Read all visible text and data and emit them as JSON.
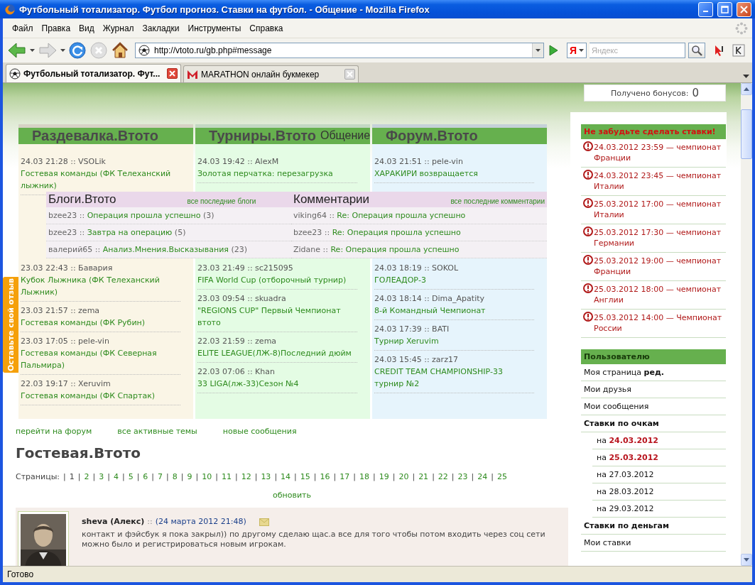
{
  "window": {
    "title": "Футбольный тотализатор. Футбол прогноз. Ставки на футбол. - Общение - Mozilla Firefox"
  },
  "menu": [
    "Файл",
    "Правка",
    "Вид",
    "Журнал",
    "Закладки",
    "Инструменты",
    "Справка"
  ],
  "address_bar": {
    "url": "http://vtoto.ru/gb.php#message"
  },
  "search": {
    "engine": "Я",
    "placeholder": "Яндекс"
  },
  "tabs": [
    {
      "label": "Футбольный тотализатор. Фут...",
      "selected": true
    },
    {
      "label": "MARATHON онлайн букмекер",
      "selected": false
    }
  ],
  "bonus": {
    "label": "Получено бонусов:",
    "value": "0"
  },
  "feedback_tab": {
    "label": "Оставьте свой отзыв"
  },
  "columns": [
    {
      "title": "Раздевалка.Втото",
      "color": "#faf5e6",
      "items": [
        {
          "meta": "24.03 21:28 :: VSOLik",
          "title": "Гостевая команды (ФК Телеханский лыжник)"
        },
        {
          "meta": "23.03 22:43 :: Бавария",
          "title": "Кубок Лыжника (ФК Телеханский Лыжник)"
        },
        {
          "meta": "23.03 21:57 :: zema",
          "title": "Гостевая команды (ФК Рубин)"
        },
        {
          "meta": "23.03 17:05 :: pele-vin",
          "title": "Гостевая команды (ФК Северная Пальмира)"
        },
        {
          "meta": "22.03 19:17 :: Xeruvim",
          "title": "Гостевая команды (ФК Спартак)"
        }
      ]
    },
    {
      "title": "Турниры.Втото",
      "color": "#e4fce4",
      "items": [
        {
          "meta": "24.03 19:42 :: AlexM",
          "title": "Золотая перчатка: перезагрузка"
        },
        {
          "meta": "23.03 21:49 :: sc215095",
          "title": "FIFA World Cup (отборочный турнир)"
        },
        {
          "meta": "23.03 09:54 :: skuadra",
          "title": "\"REGIONS CUP\" Первый Чемпионат втото"
        },
        {
          "meta": "22.03 21:59 :: zema",
          "title": "ELITE LEAGUE(ЛЖ-8)Последний дюйм"
        },
        {
          "meta": "22.03 07:06 :: Khan",
          "title": "33 LIGA(лж-33)Сезон №4"
        }
      ]
    },
    {
      "title": "Форум.Втото",
      "color": "#e6f4fc",
      "items": [
        {
          "meta": "24.03 21:51 :: pele-vin",
          "title": "ХАРАКИРИ возвращается"
        },
        {
          "meta": "24.03 18:19 :: SOKOL",
          "title": "ГОЛЕАДОР-3"
        },
        {
          "meta": "24.03 18:14 :: Dima_Apatity",
          "title": "8-й Командный Чемпионат"
        },
        {
          "meta": "24.03 17:39 :: BATI",
          "title": "Турнир Xeruvim"
        },
        {
          "meta": "24.03 15:45 :: zarz17",
          "title": "CREDIT TEAM CHAMPIONSHIP-33 турнир №2"
        }
      ]
    }
  ],
  "overlay": {
    "title": "Общение",
    "blogs": {
      "title": "Блоги.Втото",
      "link": "все последние блоги",
      "items": [
        {
          "author": "bzee23 ::",
          "title": "Операция прошла успешно",
          "count": "(3)"
        },
        {
          "author": "bzee23 ::",
          "title": "Завтра на операцию",
          "count": "(5)"
        },
        {
          "author": "валерий65 ::",
          "title": "Анализ.Мнения.Высказывания",
          "count": "(23)"
        }
      ]
    },
    "comments": {
      "title": "Комментарии",
      "link": "все последние комментарии",
      "items": [
        {
          "author": "viking64 ::",
          "title": "Re: Операция прошла успешно"
        },
        {
          "author": "bzee23 ::",
          "title": "Re: Операция прошла успешно"
        },
        {
          "author": "Zidane ::",
          "title": "Re: Операция прошла успешно"
        }
      ]
    }
  },
  "forum_links": [
    "перейти на форум",
    "все активные темы",
    "новые сообщения"
  ],
  "guestbook": {
    "title": "Гостевая.Втото",
    "pagination": {
      "label": "Страницы:",
      "separator": "|",
      "pages": [
        {
          "label": "1",
          "selected": true
        },
        {
          "label": "2",
          "selected": false
        },
        {
          "label": "3",
          "selected": false
        },
        {
          "label": "4",
          "selected": false
        },
        {
          "label": "5",
          "selected": false
        },
        {
          "label": "6",
          "selected": false
        },
        {
          "label": "7",
          "selected": false
        },
        {
          "label": "8",
          "selected": false
        },
        {
          "label": "9",
          "selected": false
        },
        {
          "label": "10",
          "selected": false
        },
        {
          "label": "11",
          "selected": false
        },
        {
          "label": "12",
          "selected": false
        },
        {
          "label": "13",
          "selected": false
        },
        {
          "label": "14",
          "selected": false
        },
        {
          "label": "15",
          "selected": false
        },
        {
          "label": "16",
          "selected": false
        },
        {
          "label": "17",
          "selected": false
        },
        {
          "label": "18",
          "selected": false
        },
        {
          "label": "19",
          "selected": false
        },
        {
          "label": "20",
          "selected": false
        },
        {
          "label": "21",
          "selected": false
        },
        {
          "label": "22",
          "selected": false
        },
        {
          "label": "23",
          "selected": false
        },
        {
          "label": "24",
          "selected": false
        },
        {
          "label": "25",
          "selected": false
        }
      ]
    },
    "refresh": "обновить",
    "posts": [
      {
        "author": "sheva (Алекс)",
        "separator": "::",
        "date": "(24 марта 2012 21:48)",
        "text": "контакт и фэйсбук я пока закрыл)) по другому сделаю щас.а все для того чтобы потом входить через соц сети можно было и регистрироваться новым игрокам."
      }
    ]
  },
  "sidebar": {
    "reminders": {
      "title": "Не забудьте сделать ставки!",
      "items": [
        "24.03.2012 23:59 — чемпионат Франции",
        "24.03.2012 23:45 — чемпионат Италии",
        "25.03.2012 17:00 — чемпионат Италии",
        "25.03.2012 17:30 — чемпионат Германии",
        "25.03.2012 19:00 — чемпионат Франции",
        "25.03.2012 18:00 — чемпионат Англии",
        "25.03.2012 14:00 — Чемпионат России"
      ]
    },
    "user_menu": {
      "title": "Пользователю",
      "items": [
        {
          "label": "Моя страница **ред.**",
          "kind": "item"
        },
        {
          "label": "Мои друзья",
          "kind": "item"
        },
        {
          "label": "Мои сообщения",
          "kind": "item"
        },
        {
          "label": "Ставки по очкам",
          "kind": "section"
        },
        {
          "label": "на **24.03.2012**",
          "kind": "sub"
        },
        {
          "label": "на **25.03.2012**",
          "kind": "sub"
        },
        {
          "label": "на 27.03.2012",
          "kind": "sub"
        },
        {
          "label": "на 28.03.2012",
          "kind": "sub"
        },
        {
          "label": "на 29.03.2012",
          "kind": "sub"
        },
        {
          "label": "Ставки по деньгам",
          "kind": "section"
        },
        {
          "label": "Мои ставки",
          "kind": "item"
        }
      ]
    }
  },
  "status_bar": {
    "text": "Готово"
  }
}
